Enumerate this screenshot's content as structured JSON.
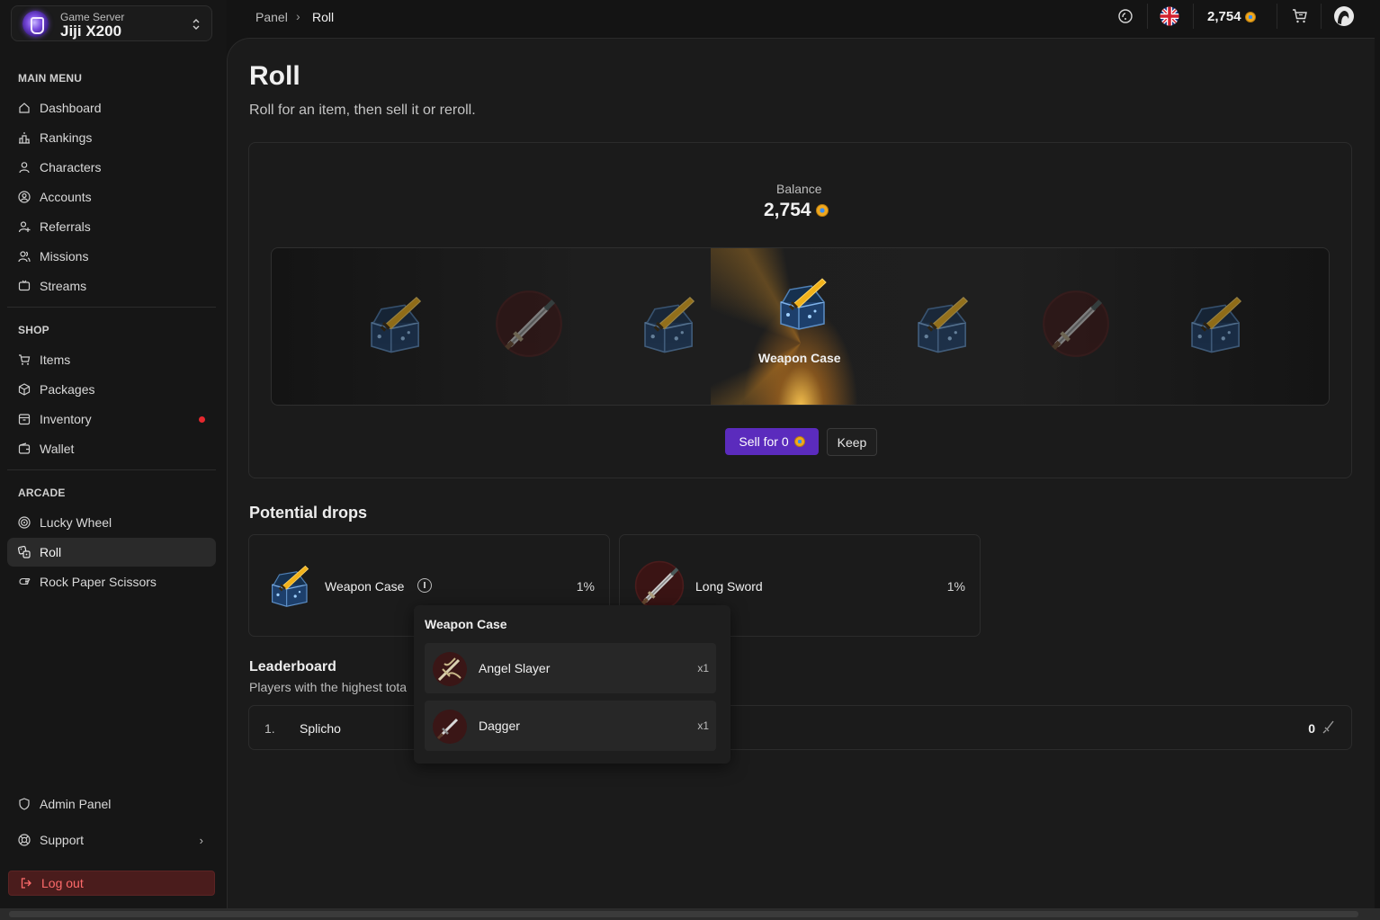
{
  "server": {
    "sub": "Game Server",
    "name": "Jiji X200"
  },
  "breadcrumb": {
    "parent": "Panel",
    "sep": "›",
    "current": "Roll"
  },
  "topbar": {
    "balance": "2,754"
  },
  "sidebar": {
    "main_title": "MAIN MENU",
    "main_items": [
      {
        "label": "Dashboard",
        "icon": "home-icon"
      },
      {
        "label": "Rankings",
        "icon": "podium-icon"
      },
      {
        "label": "Characters",
        "icon": "user-icon"
      },
      {
        "label": "Accounts",
        "icon": "user-circle-icon"
      },
      {
        "label": "Referrals",
        "icon": "user-plus-icon"
      },
      {
        "label": "Missions",
        "icon": "users-icon"
      },
      {
        "label": "Streams",
        "icon": "tv-icon"
      }
    ],
    "shop_title": "SHOP",
    "shop_items": [
      {
        "label": "Items",
        "icon": "cart-icon"
      },
      {
        "label": "Packages",
        "icon": "box-icon"
      },
      {
        "label": "Inventory",
        "icon": "archive-icon"
      },
      {
        "label": "Wallet",
        "icon": "wallet-icon"
      }
    ],
    "arcade_title": "ARCADE",
    "arcade_items": [
      {
        "label": "Lucky Wheel",
        "icon": "wheel-icon"
      },
      {
        "label": "Roll",
        "icon": "dice-icon"
      },
      {
        "label": "Rock Paper Scissors",
        "icon": "hand-icon"
      }
    ],
    "admin_label": "Admin Panel",
    "support_label": "Support",
    "logout_label": "Log out"
  },
  "page": {
    "title": "Roll",
    "subtitle": "Roll for an item, then sell it or reroll."
  },
  "roll": {
    "balance_label": "Balance",
    "balance_value": "2,754",
    "reel_items": [
      "weapon-case",
      "long-sword",
      "weapon-case",
      "weapon-case",
      "weapon-case",
      "long-sword",
      "weapon-case"
    ],
    "winner_label": "Weapon Case",
    "sell_label": "Sell for 0",
    "keep_label": "Keep"
  },
  "drops": {
    "title": "Potential drops",
    "items": [
      {
        "name": "Weapon Case",
        "pct": "1%"
      },
      {
        "name": "Long Sword",
        "pct": "1%"
      }
    ]
  },
  "popover": {
    "title": "Weapon Case",
    "items": [
      {
        "name": "Angel Slayer",
        "qty": "x1"
      },
      {
        "name": "Dagger",
        "qty": "x1"
      }
    ]
  },
  "leaderboard": {
    "title": "Leaderboard",
    "subtitle": "Players with the highest tota",
    "rows": [
      {
        "rank": "1.",
        "name": "Splicho",
        "score": "0"
      }
    ]
  },
  "colors": {
    "accent": "#5b2bbd",
    "danger": "#e5282e",
    "coin": "#f0a81e"
  }
}
